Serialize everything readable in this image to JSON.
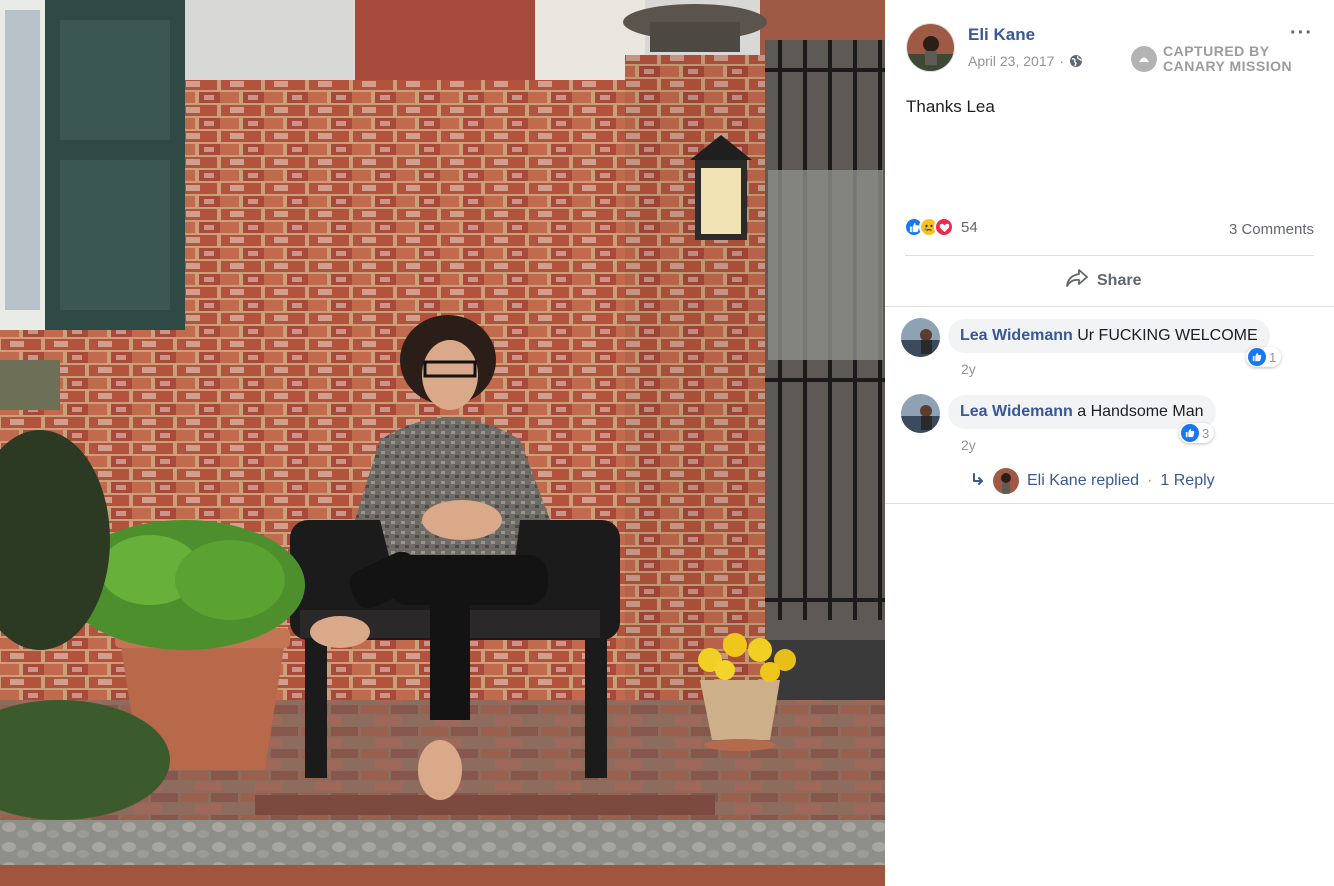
{
  "photo": {
    "alt": ""
  },
  "post": {
    "author": "Eli Kane",
    "date": "April 23, 2017",
    "separator": "·",
    "more_label": "···",
    "text": "Thanks Lea",
    "watermark": {
      "line1": "CAPTURED BY",
      "line2": "CANARY MISSION"
    },
    "reactions": {
      "icons": [
        "like-icon",
        "sad-icon",
        "love-icon"
      ],
      "count": "54"
    },
    "comments_count": "3 Comments",
    "share_label": "Share"
  },
  "comments": [
    {
      "name": "Lea Widemann",
      "text": "Ur FUCKING WELCOME",
      "time": "2y",
      "likes": "1"
    },
    {
      "name": "Lea Widemann",
      "text": "a Handsome Man",
      "time": "2y",
      "likes": "3"
    }
  ],
  "reply": {
    "text": "Eli Kane replied",
    "separator": "·",
    "count_label": "1 Reply"
  },
  "colors": {
    "link": "#385898",
    "muted": "#90949c",
    "like": "#1877f2",
    "love": "#f0284a",
    "sad": "#f7c31c"
  }
}
